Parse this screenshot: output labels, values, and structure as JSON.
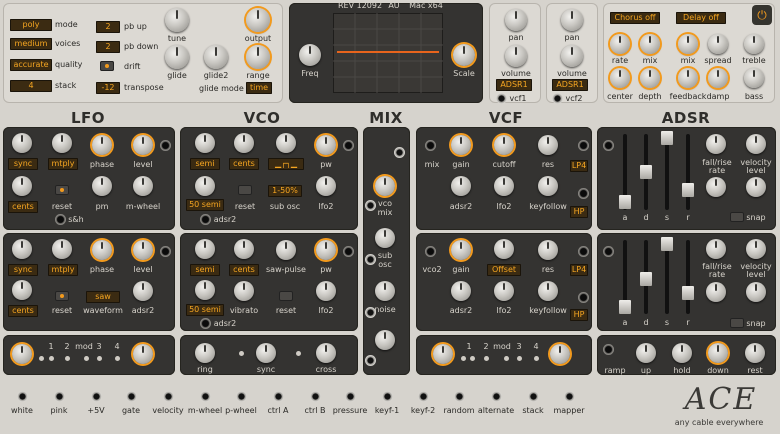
{
  "header": {
    "rev": "REV 12092",
    "au": "AU",
    "arch": "Mac x64",
    "freq_label": "Freq",
    "scale_label": "Scale"
  },
  "global": {
    "poly": "poly",
    "mode": "mode",
    "medium": "medium",
    "voices": "voices",
    "accurate": "accurate",
    "quality": "quality",
    "stack_value": "4",
    "stack": "stack",
    "pbup_value": "2",
    "pbup": "pb up",
    "pbdown_value": "2",
    "pbdown": "pb down",
    "drift": "drift",
    "transpose_value": "-12",
    "transpose": "transpose",
    "tune": "tune",
    "glide": "glide",
    "glide2": "glide2",
    "output": "output",
    "range": "range",
    "glide_mode": "glide mode",
    "glide_mode_value": "time"
  },
  "vcf_env": {
    "pan": "pan",
    "volume": "volume",
    "adsr1": "ADSR1",
    "vcf1": "vcf1",
    "vcf2": "vcf2"
  },
  "fx": {
    "chorus": "Chorus off",
    "delay": "Delay off",
    "rate": "rate",
    "mix": "mix",
    "center": "center",
    "depth": "depth",
    "mix2": "mix",
    "spread": "spread",
    "feedback": "feedback",
    "damp": "damp",
    "treble": "treble",
    "bass": "bass"
  },
  "sections": {
    "lfo": "LFO",
    "vco": "VCO",
    "mix": "MIX",
    "vcf": "VCF",
    "adsr": "ADSR"
  },
  "lfo": {
    "sync": "sync",
    "mtply": "mtply",
    "phase": "phase",
    "level": "level",
    "cents": "cents",
    "reset": "reset",
    "pm": "pm",
    "mwheel": "m-wheel",
    "sh": "s&h",
    "saw": "saw",
    "waveform": "waveform",
    "adsr2": "adsr2"
  },
  "vco": {
    "semi": "semi",
    "cents": "cents",
    "pw": "pw",
    "semi50": "50 semi",
    "reset": "reset",
    "suboct": "1-50%",
    "subosc": "sub osc",
    "lfo2": "lfo2",
    "adsr2": "adsr2",
    "sawpulse": "saw-pulse",
    "vibrato": "vibrato",
    "ring": "ring",
    "sync": "sync",
    "cross": "cross"
  },
  "mix": {
    "vcomix": "vco mix",
    "subosc": "sub osc",
    "noise": "noise"
  },
  "vcf": {
    "mix": "mix",
    "gain": "gain",
    "cutoff": "cutoff",
    "res": "res",
    "lp4": "LP4",
    "hp": "HP",
    "adsr2": "adsr2",
    "lfo2": "lfo2",
    "keyfollow": "keyfollow",
    "vco2": "vco2",
    "offset": "Offset"
  },
  "adsr": {
    "a": "a",
    "d": "d",
    "s": "s",
    "r": "r",
    "fallrise": "fall/rise",
    "rate": "rate",
    "velocity": "velocity",
    "level": "level",
    "snap": "snap",
    "ramp": "ramp",
    "up": "up",
    "hold": "hold",
    "down": "down",
    "rest": "rest"
  },
  "mod": {
    "n1": "1",
    "n2": "2",
    "mod": "mod",
    "n3": "3",
    "n4": "4"
  },
  "bottom": {
    "sources": [
      "white",
      "pink",
      "+5V",
      "gate",
      "velocity",
      "m-wheel",
      "p-wheel",
      "ctrl A",
      "ctrl B",
      "pressure",
      "keyf-1",
      "keyf-2",
      "random",
      "alternate",
      "stack",
      "mapper"
    ],
    "logo": "ACE",
    "tagline": "any cable everywhere"
  },
  "colors": {
    "accent": "#f29a1d",
    "lcd_bg": "#3b2b12",
    "panel": "#343331",
    "scope_line": "#e8641c"
  }
}
